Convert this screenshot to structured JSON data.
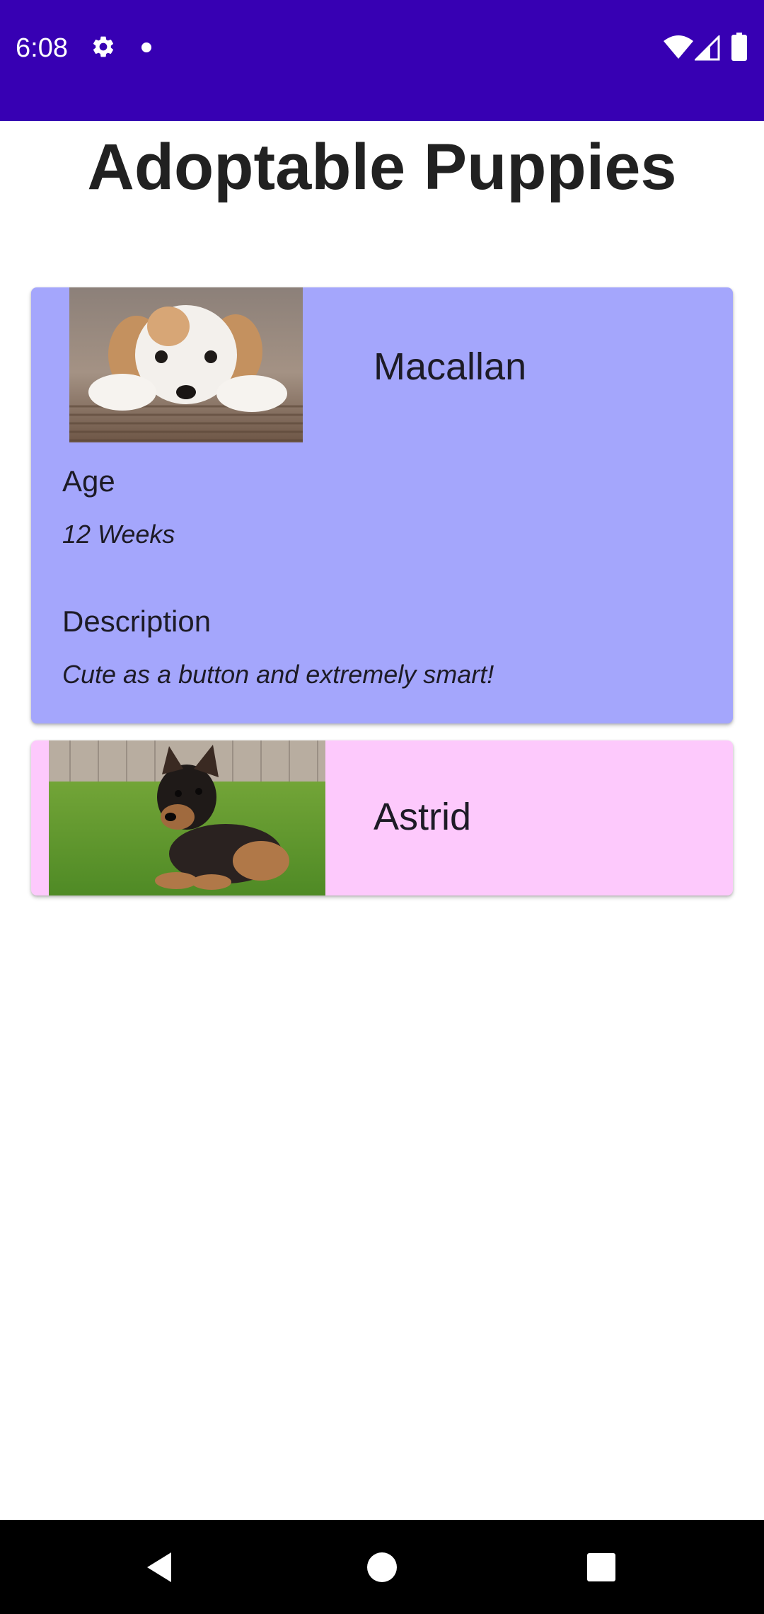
{
  "status_bar": {
    "time": "6:08",
    "icons": [
      "gear-icon",
      "notification-dot-icon",
      "wifi-icon",
      "cell-signal-icon",
      "battery-icon"
    ],
    "background_color": "#3700b3"
  },
  "header": {
    "title": "Adoptable Puppies"
  },
  "puppies": [
    {
      "name": "Macallan",
      "photo": "white-and-tan-puppy-photo",
      "expanded": true,
      "card_color": "#a4a6fc",
      "age_label": "Age",
      "age_value": "12 Weeks",
      "description_label": "Description",
      "description_value": "Cute as a button and extremely smart!"
    },
    {
      "name": "Astrid",
      "photo": "german-shepherd-puppy-photo",
      "expanded": false,
      "card_color": "#fdc9fc"
    }
  ],
  "nav_bar": {
    "icons": [
      "back-icon",
      "home-icon",
      "recents-icon"
    ]
  }
}
